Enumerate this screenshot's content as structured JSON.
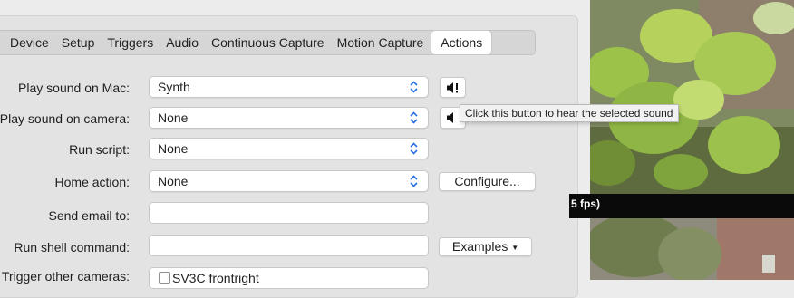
{
  "tabs": [
    {
      "label": "Device",
      "active": false
    },
    {
      "label": "Setup",
      "active": false
    },
    {
      "label": "Triggers",
      "active": false
    },
    {
      "label": "Audio",
      "active": false
    },
    {
      "label": "Continuous Capture",
      "active": false
    },
    {
      "label": "Motion Capture",
      "active": false
    },
    {
      "label": "Actions",
      "active": true
    }
  ],
  "rows": {
    "play_sound_mac": {
      "label": "Play sound on Mac:",
      "value": "Synth"
    },
    "play_sound_camera": {
      "label": "Play sound on camera:",
      "value": "None"
    },
    "run_script": {
      "label": "Run script:",
      "value": "None"
    },
    "home_action": {
      "label": "Home action:",
      "value": "None"
    },
    "send_email": {
      "label": "Send email to:",
      "value": ""
    },
    "run_shell": {
      "label": "Run shell command:",
      "value": ""
    },
    "trigger_cameras": {
      "label": "Trigger other cameras:",
      "checkbox_label": "SV3C frontright"
    }
  },
  "buttons": {
    "configure": "Configure...",
    "examples": "Examples"
  },
  "icons": {
    "speaker": "speaker-icon",
    "speaker_alert": "speaker-alert-icon",
    "dropdown": "chevron-updown-icon"
  },
  "tooltip": "Click this button to hear the selected sound",
  "video": {
    "status_text": "5 fps)"
  },
  "colors": {
    "panel": "#e3e3e3",
    "window": "#ececec",
    "tabbar": "#d6d6d6",
    "video_bar": "#0a0a0a"
  }
}
